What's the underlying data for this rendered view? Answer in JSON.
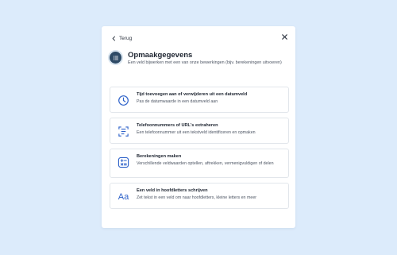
{
  "nav": {
    "back_label": "Terug"
  },
  "header": {
    "title": "Opmaakgegevens",
    "subtitle": "Een veld bijwerken met een van onze bewerkingen (bijv. berekeningen uitvoeren)"
  },
  "options": [
    {
      "title": "Tijd toevoegen aan of verwijderen uit een datumveld",
      "description": "Pas de datumwaarde in een datumveld aan",
      "icon": "clock-icon"
    },
    {
      "title": "Telefoonnummers of URL's extraheren",
      "description": "Een telefoonnummer uit een tekstveld identificeren en opmaken",
      "icon": "phone-scan-icon"
    },
    {
      "title": "Berekeningen maken",
      "description": "Verschillende veldwaarden optellen, aftrekken, vermenigvuldigen of delen",
      "icon": "calculator-icon"
    },
    {
      "title": "Een veld in hoofdletters schrijven",
      "description": "Zet tekst in een veld om naar hoofdletters, kleine letters en meer",
      "icon": "aa-icon",
      "icon_text": "Aa"
    }
  ],
  "colors": {
    "accent": "#2e62c9",
    "header_icon_bg": "#2e4a66",
    "background": "#dcebfb"
  }
}
